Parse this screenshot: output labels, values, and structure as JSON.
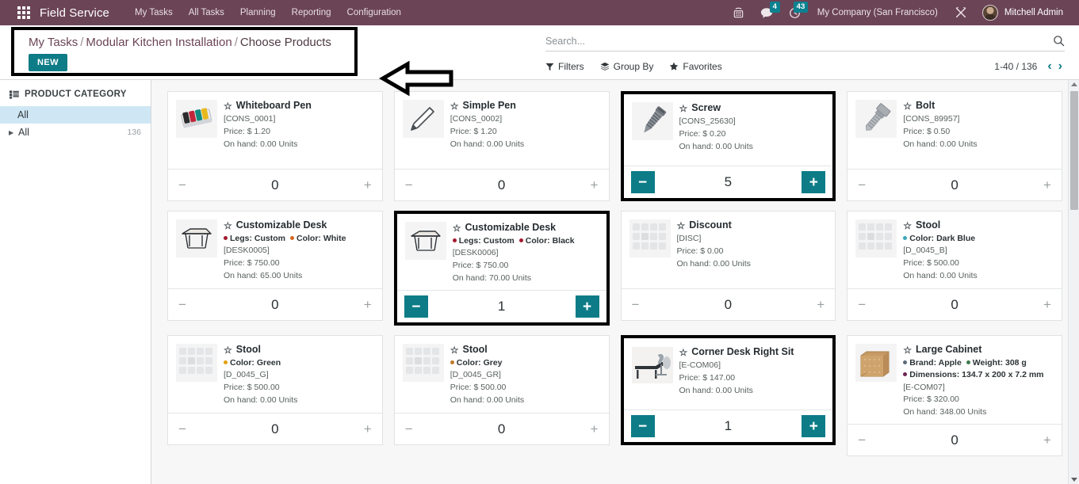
{
  "navbar": {
    "apps_icon": "apps-grid-icon",
    "brand": "Field Service",
    "menu": [
      "My Tasks",
      "All Tasks",
      "Planning",
      "Reporting",
      "Configuration"
    ],
    "icons": [
      {
        "name": "voip-phone-icon",
        "badge": null
      },
      {
        "name": "messages-icon",
        "badge": "4"
      },
      {
        "name": "activities-clock-icon",
        "badge": "43"
      }
    ],
    "company": "My Company (San Francisco)",
    "debug_icon": "tools-wrench-icon",
    "avatar": "user-avatar",
    "user": "Mitchell Admin"
  },
  "control_panel": {
    "breadcrumb": [
      "My Tasks",
      "Modular Kitchen Installation",
      "Choose Products"
    ],
    "new_label": "NEW",
    "annotation": "left-pointing-arrow"
  },
  "search": {
    "placeholder": "Search...",
    "value": "",
    "icon": "search-icon"
  },
  "toolbar": {
    "filters": "Filters",
    "group_by": "Group By",
    "favorites": "Favorites",
    "pager_count": "1-40 / 136",
    "prev": "‹",
    "next": "›"
  },
  "sidebar": {
    "title": "PRODUCT CATEGORY",
    "title_icon": "list-icon",
    "items": [
      {
        "label": "All",
        "count": "",
        "selected": true,
        "expandable": false
      },
      {
        "label": "All",
        "count": "136",
        "selected": false,
        "expandable": true
      }
    ]
  },
  "colors": {
    "navbar": "#6b4456",
    "accent_teal": "#0d7c87",
    "selected_cat": "#cfe7f5",
    "highlight_border": "#000000"
  },
  "products": [
    {
      "name": "Whiteboard Pen",
      "attrs": [],
      "code": "[CONS_0001]",
      "price": "Price: $ 1.20",
      "onhand": "On hand: 0.00 Units",
      "qty": "0",
      "selected": false,
      "active_qty": false,
      "image": "whiteboard-pen-image"
    },
    {
      "name": "Simple Pen",
      "attrs": [],
      "code": "[CONS_0002]",
      "price": "Price: $ 1.20",
      "onhand": "On hand: 0.00 Units",
      "qty": "0",
      "selected": false,
      "active_qty": false,
      "image": "simple-pen-image"
    },
    {
      "name": "Screw",
      "attrs": [],
      "code": "[CONS_25630]",
      "price": "Price: $ 0.20",
      "onhand": "On hand: 0.00 Units",
      "qty": "5",
      "selected": true,
      "active_qty": true,
      "image": "screw-image"
    },
    {
      "name": "Bolt",
      "attrs": [],
      "code": "[CONS_89957]",
      "price": "Price: $ 0.50",
      "onhand": "On hand: 0.00 Units",
      "qty": "0",
      "selected": false,
      "active_qty": false,
      "image": "bolt-image"
    },
    {
      "name": "Customizable Desk",
      "attrs": [
        {
          "text": "Legs: Custom",
          "color": "#a31b2f"
        },
        {
          "text": "Color: White",
          "color": "#d4651f"
        }
      ],
      "code": "[DESK0005]",
      "price": "Price: $ 750.00",
      "onhand": "On hand: 65.00 Units",
      "qty": "0",
      "selected": false,
      "active_qty": false,
      "image": "desk-white-image"
    },
    {
      "name": "Customizable Desk",
      "attrs": [
        {
          "text": "Legs: Custom",
          "color": "#a31b2f"
        },
        {
          "text": "Color: Black",
          "color": "#a31b2f"
        }
      ],
      "code": "[DESK0006]",
      "price": "Price: $ 750.00",
      "onhand": "On hand: 70.00 Units",
      "qty": "1",
      "selected": true,
      "active_qty": true,
      "image": "desk-black-image"
    },
    {
      "name": "Discount",
      "attrs": [],
      "code": "[DISC]",
      "price": "Price: $ 0.00",
      "onhand": "On hand: 0.00 Units",
      "qty": "0",
      "selected": false,
      "active_qty": false,
      "image": "placeholder-image"
    },
    {
      "name": "Stool",
      "attrs": [
        {
          "text": "Color: Dark Blue",
          "color": "#3aa6b9"
        }
      ],
      "code": "[D_0045_B]",
      "price": "Price: $ 500.00",
      "onhand": "On hand: 0.00 Units",
      "qty": "0",
      "selected": false,
      "active_qty": false,
      "image": "placeholder-image"
    },
    {
      "name": "Stool",
      "attrs": [
        {
          "text": "Color: Green",
          "color": "#e2a008"
        }
      ],
      "code": "[D_0045_G]",
      "price": "Price: $ 500.00",
      "onhand": "On hand: 0.00 Units",
      "qty": "0",
      "selected": false,
      "active_qty": false,
      "image": "placeholder-image"
    },
    {
      "name": "Stool",
      "attrs": [
        {
          "text": "Color: Grey",
          "color": "#c07a2a"
        }
      ],
      "code": "[D_0045_GR]",
      "price": "Price: $ 500.00",
      "onhand": "On hand: 0.00 Units",
      "qty": "0",
      "selected": false,
      "active_qty": false,
      "image": "placeholder-image"
    },
    {
      "name": "Corner Desk Right Sit",
      "attrs": [],
      "code": "[E-COM06]",
      "price": "Price: $ 147.00",
      "onhand": "On hand: 0.00 Units",
      "qty": "1",
      "selected": true,
      "active_qty": true,
      "image": "corner-desk-image"
    },
    {
      "name": "Large Cabinet",
      "attrs": [
        {
          "text": "Brand: Apple",
          "color": "#5b6a7a"
        },
        {
          "text": "Weight: 308 g",
          "color": "#3f7d4e"
        },
        {
          "text": "Dimensions: 134.7 x 200 x 7.2 mm",
          "color": "#6b2352"
        }
      ],
      "code": "[E-COM07]",
      "price": "Price: $ 320.00",
      "onhand": "On hand: 348.00 Units",
      "qty": "0",
      "selected": false,
      "active_qty": false,
      "image": "large-cabinet-image"
    }
  ],
  "quantity_controls": {
    "minus": "−",
    "plus": "+"
  }
}
